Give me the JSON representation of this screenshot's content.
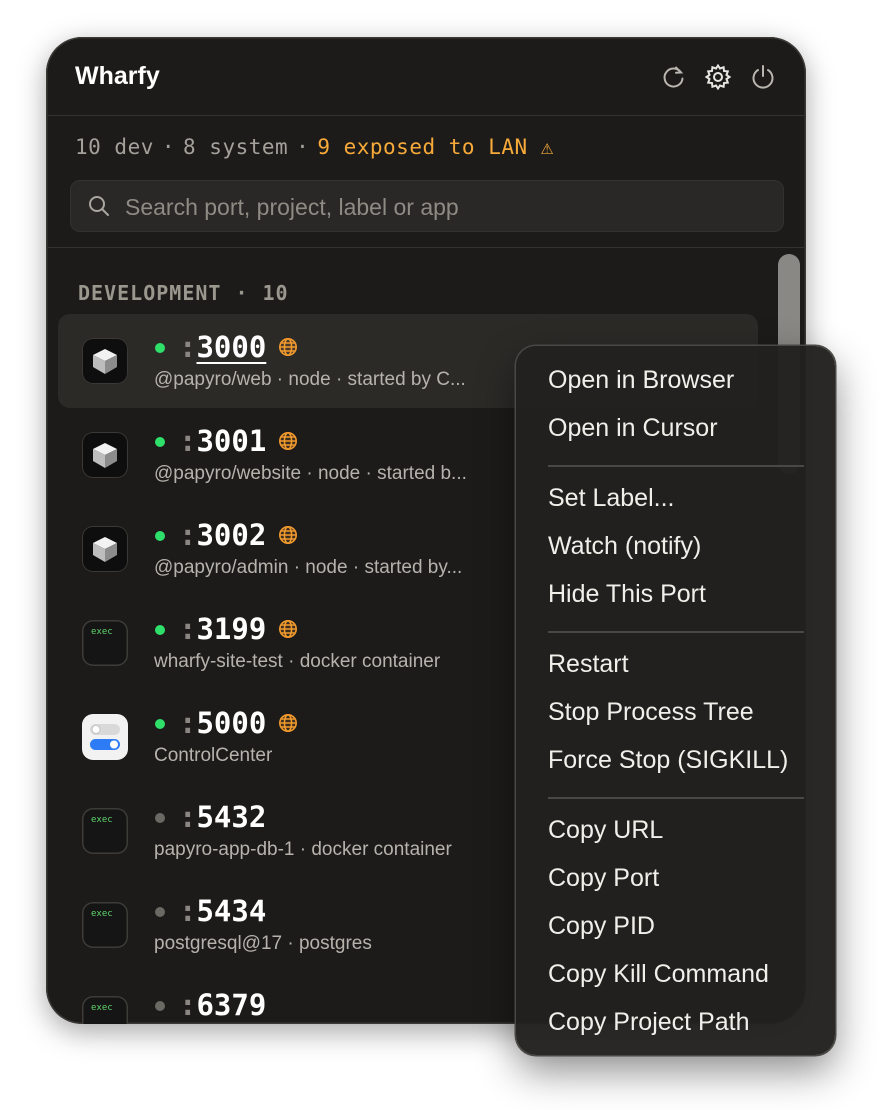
{
  "app": {
    "title": "Wharfy",
    "icons": [
      "refresh-icon",
      "gear-icon",
      "power-icon"
    ]
  },
  "summary": {
    "dev": "10 dev",
    "sep": "·",
    "system": "8 system",
    "exposed": "9 exposed to LAN ⚠"
  },
  "search": {
    "placeholder": "Search port, project, label or app",
    "value": ""
  },
  "section": {
    "title": "DEVELOPMENT",
    "dot": "·",
    "count": "10"
  },
  "rows": [
    {
      "colon": ":",
      "port": "3000",
      "sub": "@papyro/web · node · started by C...",
      "active": true,
      "lan": true,
      "icon": "cube"
    },
    {
      "colon": ":",
      "port": "3001",
      "sub": "@papyro/website · node · started b...",
      "active": true,
      "lan": true,
      "icon": "cube"
    },
    {
      "colon": ":",
      "port": "3002",
      "sub": "@papyro/admin · node · started by...",
      "active": true,
      "lan": true,
      "icon": "cube"
    },
    {
      "colon": ":",
      "port": "3199",
      "sub": "wharfy-site-test · docker container",
      "active": true,
      "lan": true,
      "icon": "exec",
      "icon_text": "exec"
    },
    {
      "colon": ":",
      "port": "5000",
      "sub": "ControlCenter",
      "active": true,
      "lan": true,
      "icon": "controlcenter"
    },
    {
      "colon": ":",
      "port": "5432",
      "sub": "papyro-app-db-1 · docker container",
      "active": false,
      "lan": false,
      "icon": "exec",
      "icon_text": "exec"
    },
    {
      "colon": ":",
      "port": "5434",
      "sub": "postgresql@17 · postgres",
      "active": false,
      "lan": false,
      "icon": "exec",
      "icon_text": "exec"
    },
    {
      "colon": ":",
      "port": "6379",
      "sub": "",
      "active": false,
      "lan": false,
      "icon": "exec",
      "icon_text": "exec"
    }
  ],
  "context_menu": {
    "groups": [
      [
        "Open in Browser",
        "Open in Cursor"
      ],
      [
        "Set Label...",
        "Watch (notify)",
        "Hide This Port"
      ],
      [
        "Restart",
        "Stop Process Tree",
        "Force Stop (SIGKILL)"
      ],
      [
        "Copy URL",
        "Copy Port",
        "Copy PID",
        "Copy Kill Command",
        "Copy Project Path"
      ]
    ]
  },
  "colors": {
    "window_bg": "#1c1b19",
    "warning": "#f7a93a",
    "active_dot": "#2ee06a",
    "inactive_dot": "#6b6964",
    "lan_icon": "#f29a2e"
  }
}
